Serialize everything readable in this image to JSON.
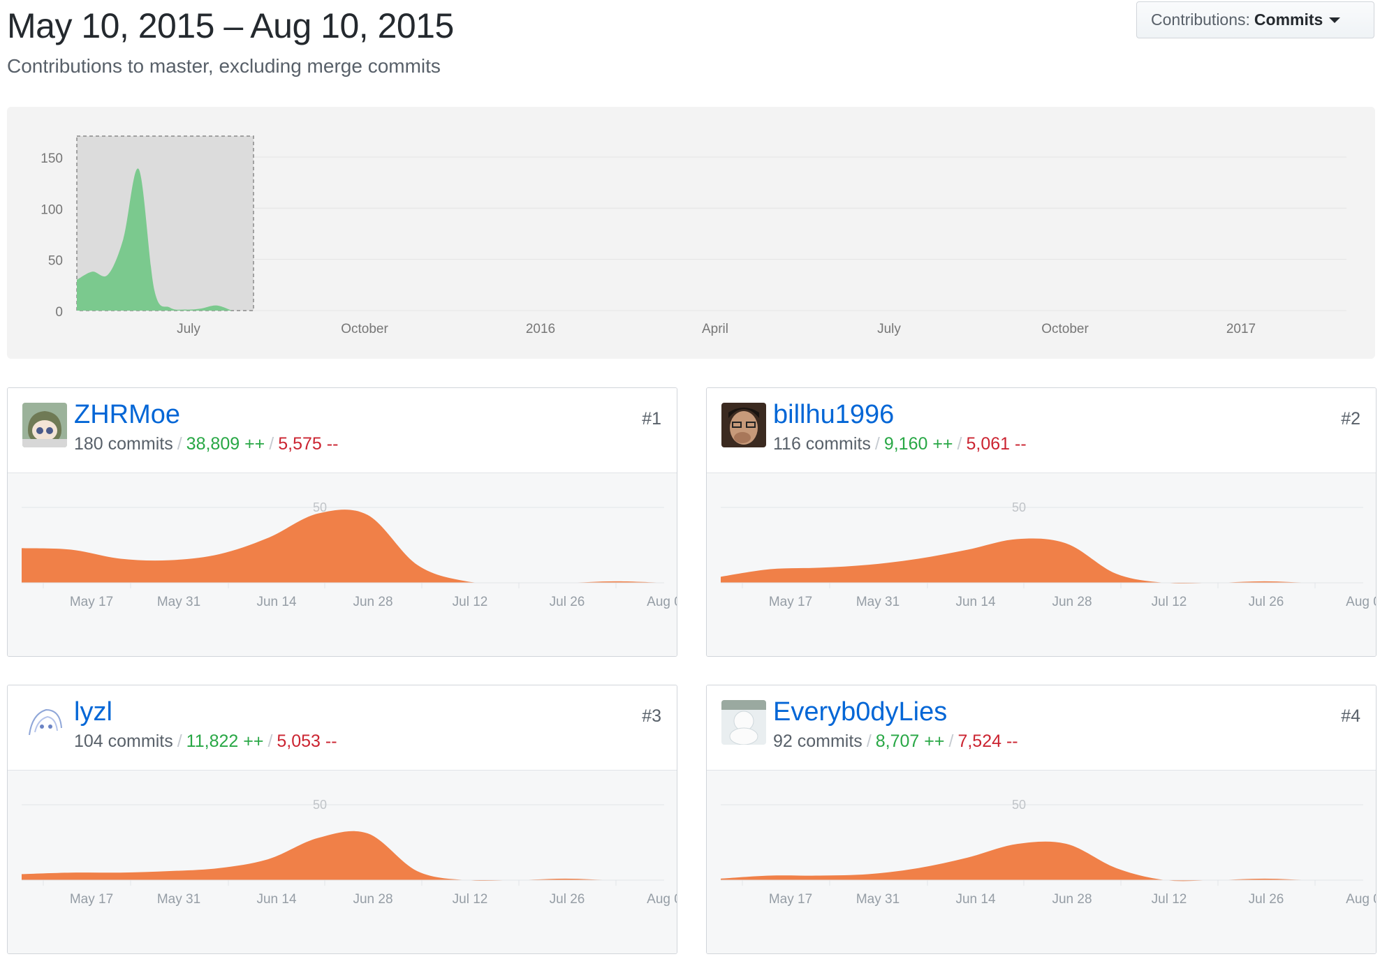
{
  "header": {
    "title": "May 10, 2015 – Aug 10, 2015",
    "subtitle": "Contributions to master, excluding merge commits",
    "select": {
      "label": "Contributions:",
      "value": "Commits"
    }
  },
  "overview_chart": {
    "y_ticks": [
      "0",
      "50",
      "100",
      "150"
    ],
    "x_ticks": [
      "July",
      "October",
      "2016",
      "April",
      "July",
      "October",
      "2017"
    ],
    "colors": {
      "area": "#7bc98e",
      "selection": "#dcdcdc"
    }
  },
  "contributors": [
    {
      "rank": "#1",
      "username": "ZHRMoe",
      "commits": "180 commits",
      "additions": "38,809 ++",
      "deletions": "5,575 --",
      "avatar": "anime-avatar-icon"
    },
    {
      "rank": "#2",
      "username": "billhu1996",
      "commits": "116 commits",
      "additions": "9,160 ++",
      "deletions": "5,061 --",
      "avatar": "photo-avatar-icon"
    },
    {
      "rank": "#3",
      "username": "lyzl",
      "commits": "104 commits",
      "additions": "11,822 ++",
      "deletions": "5,053 --",
      "avatar": "sketch-avatar-icon"
    },
    {
      "rank": "#4",
      "username": "Everyb0dyLies",
      "commits": "92 commits",
      "additions": "8,707 ++",
      "deletions": "7,524 --",
      "avatar": "snowman-avatar-icon"
    }
  ],
  "card_chart": {
    "y_tick": "50",
    "x_ticks": [
      "May 17",
      "May 31",
      "Jun 14",
      "Jun 28",
      "Jul 12",
      "Jul 26",
      "Aug 0"
    ],
    "color": "#f08048"
  },
  "chart_data": [
    {
      "type": "area",
      "title": "",
      "x": [
        "2015-05-10",
        "2015-05-17",
        "2015-05-31",
        "2015-06-07",
        "2015-06-14",
        "2015-06-21",
        "2015-06-28",
        "2015-07-12",
        "2015-07-26",
        "2015-08-02",
        "2015-08-10"
      ],
      "series": [
        {
          "values": [
            30,
            38,
            35,
            70,
            138,
            20,
            3,
            1,
            2,
            5,
            0
          ]
        }
      ],
      "ylim": [
        0,
        160
      ],
      "x_ticks": [
        "July",
        "October",
        "2016",
        "April",
        "July",
        "October",
        "2017"
      ]
    },
    {
      "type": "area",
      "series": [
        {
          "name": "ZHRMoe",
          "values": [
            23,
            22,
            16,
            15,
            19,
            30,
            46,
            45,
            12,
            1,
            0,
            0,
            1,
            0
          ]
        },
        {
          "name": "billhu1996",
          "values": [
            4,
            9,
            10,
            12,
            16,
            22,
            29,
            26,
            6,
            0,
            0,
            1,
            0,
            0
          ]
        },
        {
          "name": "lyzl",
          "values": [
            4,
            5,
            5,
            6,
            8,
            14,
            28,
            31,
            6,
            0,
            0,
            1,
            0,
            0
          ]
        },
        {
          "name": "Everyb0dyLies",
          "values": [
            1,
            3,
            3,
            4,
            8,
            15,
            24,
            24,
            8,
            0,
            0,
            1,
            0,
            0
          ]
        }
      ],
      "x_ticks": [
        "May 17",
        "May 31",
        "Jun 14",
        "Jun 28",
        "Jul 12",
        "Jul 26",
        "Aug 0"
      ],
      "y_tick": "50"
    }
  ]
}
